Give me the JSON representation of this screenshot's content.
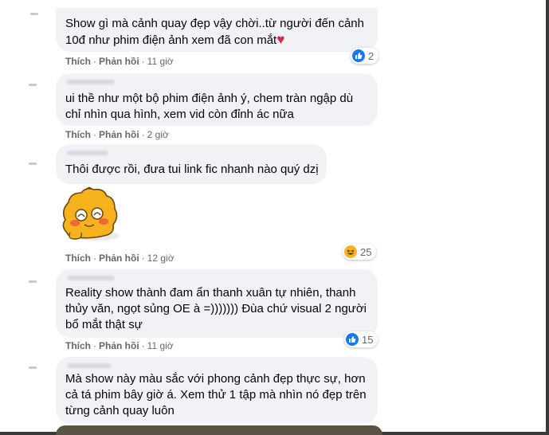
{
  "comments": [
    {
      "lines": [
        "Show gì mà cảnh quay đẹp vậy chời..từ người đến cảnh",
        "10đ như phim điện ảnh xem đã con mắt"
      ],
      "heart": "♥",
      "like_label": "Thích",
      "reply_label": "Phản hồi",
      "time": "11 giờ",
      "reaction_count": "2"
    },
    {
      "lines": [
        "ui thề như một bộ phim điện ảnh ý, chem tràn ngập dù",
        "chỉ nhìn qua hình, xem vid còn đỉnh ác nữa"
      ],
      "like_label": "Thích",
      "reply_label": "Phản hồi",
      "time": "2 giờ"
    },
    {
      "lines": [
        "Thôi được rồi, đưa tui link fic nhanh nào quý dzị"
      ],
      "like_label": "Thích",
      "reply_label": "Phản hồi",
      "time": "12 giờ",
      "reaction_count": "25"
    },
    {
      "lines": [
        "Reality show thành đam ẩn thanh xuân tự nhiên, thanh",
        "thủy văn, ngọt sủng OE à =))))))) Đùa chứ visual 2 người",
        "bổ mắt thật sự"
      ],
      "like_label": "Thích",
      "reply_label": "Phản hồi",
      "time": "11 giờ",
      "reaction_count": "15"
    },
    {
      "lines": [
        "Mà show này màu sắc với phong cảnh đẹp thực sự, hơn",
        "cả tá phim bây giờ á. Xem thử 1 tập mà nhìn nó đẹp trên",
        "từng cảnh quay luôn"
      ]
    }
  ],
  "colors": {
    "bubble": "#f0f2f5",
    "meta": "#65676b",
    "like_blue": "#1877f2",
    "heart_red": "#e41e3f",
    "haha_yellow": "#f7b125"
  },
  "icons": [
    "like-icon",
    "haha-icon",
    "heart-emoji",
    "sticker"
  ]
}
